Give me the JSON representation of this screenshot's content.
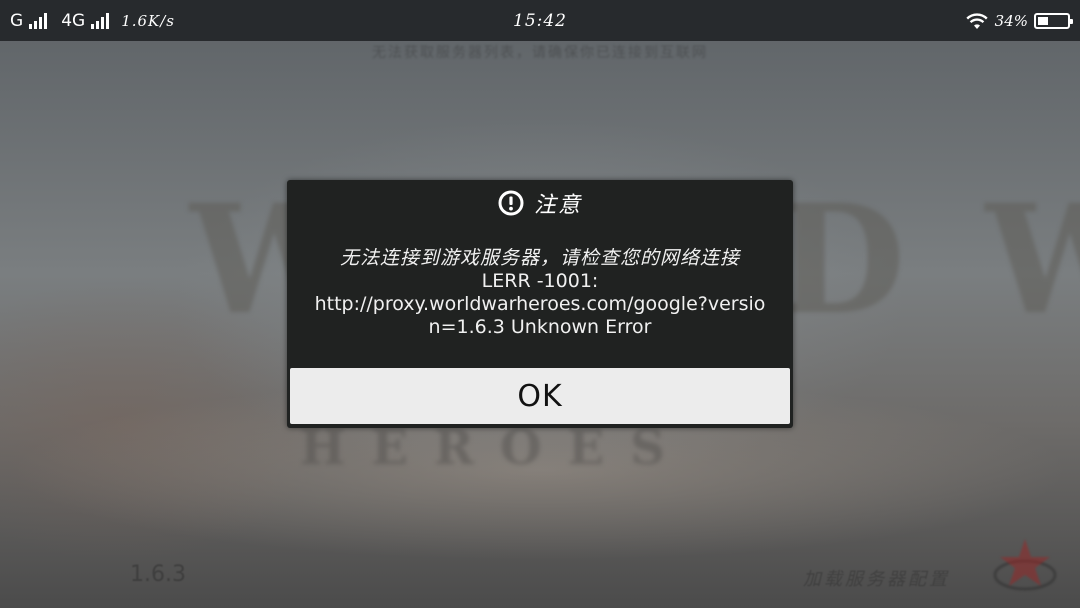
{
  "status_bar": {
    "carrier1": "G",
    "carrier2": "4G",
    "speed": "1.6K/s",
    "time": "15:42",
    "battery_percent": "34%"
  },
  "background": {
    "notice": "无法获取服务器列表，请确保你已连接到互联网",
    "logo_title": "WORLD WAR",
    "logo_subtitle": "HEROES",
    "version": "1.6.3",
    "loading": "加载服务器配置"
  },
  "dialog": {
    "title": "注意",
    "message_cn": "无法连接到游戏服务器，请检查您的网络连接",
    "message_code": "LERR -1001:",
    "message_url_line1": "http://proxy.worldwarheroes.com/google?versio",
    "message_url_line2": "n=1.6.3 Unknown Error",
    "ok_label": "OK"
  },
  "colors": {
    "dialog_bg": "#202221",
    "button_bg": "#ececec",
    "status_bar_bg": "#232528"
  },
  "icons": {
    "dialog": "alert-circle-icon",
    "status": [
      "signal-icon",
      "wifi-icon",
      "battery-icon"
    ]
  }
}
